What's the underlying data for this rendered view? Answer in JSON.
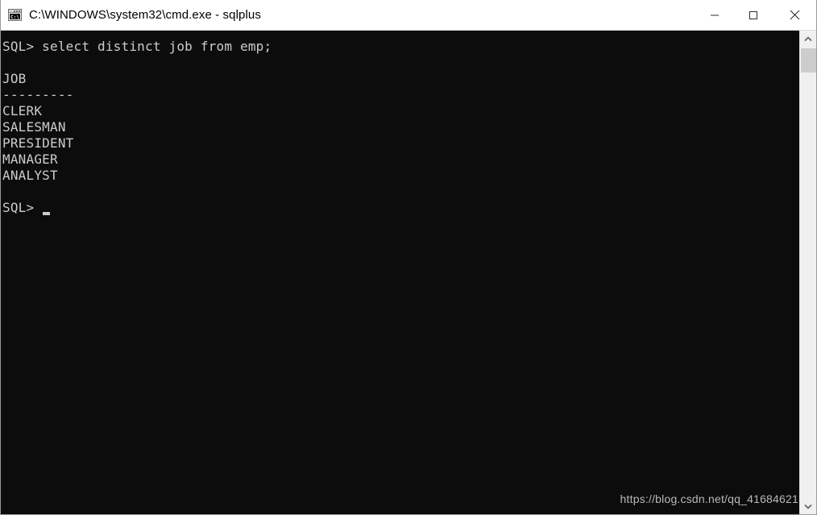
{
  "window": {
    "title": "C:\\WINDOWS\\system32\\cmd.exe - sqlplus",
    "icon": "cmd-icon",
    "icon_glyph": "C:\\",
    "background_color": "#0c0c0c",
    "titlebar_color": "#ffffff",
    "text_color": "#cccccc"
  },
  "controls": {
    "minimize": "minimize-icon",
    "maximize": "maximize-icon",
    "close": "close-icon"
  },
  "console": {
    "lines": [
      "SQL> select distinct job from emp;",
      "",
      "JOB",
      "---------",
      "CLERK",
      "SALESMAN",
      "PRESIDENT",
      "MANAGER",
      "ANALYST",
      "",
      "SQL> "
    ],
    "text": "SQL> select distinct job from emp;\n\nJOB\n---------\nCLERK\nSALESMAN\nPRESIDENT\nMANAGER\nANALYST\n\nSQL> ",
    "prompt": "SQL>",
    "command": "select distinct job from emp;",
    "result": {
      "column_header": "JOB",
      "separator": "---------",
      "rows": [
        "CLERK",
        "SALESMAN",
        "PRESIDENT",
        "MANAGER",
        "ANALYST"
      ]
    },
    "cursor": "block-cursor"
  },
  "scrollbar": {
    "up_arrow": "chevron-up-icon",
    "down_arrow": "chevron-down-icon",
    "thumb": "scrollbar-thumb",
    "track_color": "#f0f0f0",
    "thumb_color": "#cdcdcd"
  },
  "watermark": {
    "text": "https://blog.csdn.net/qq_41684621"
  }
}
